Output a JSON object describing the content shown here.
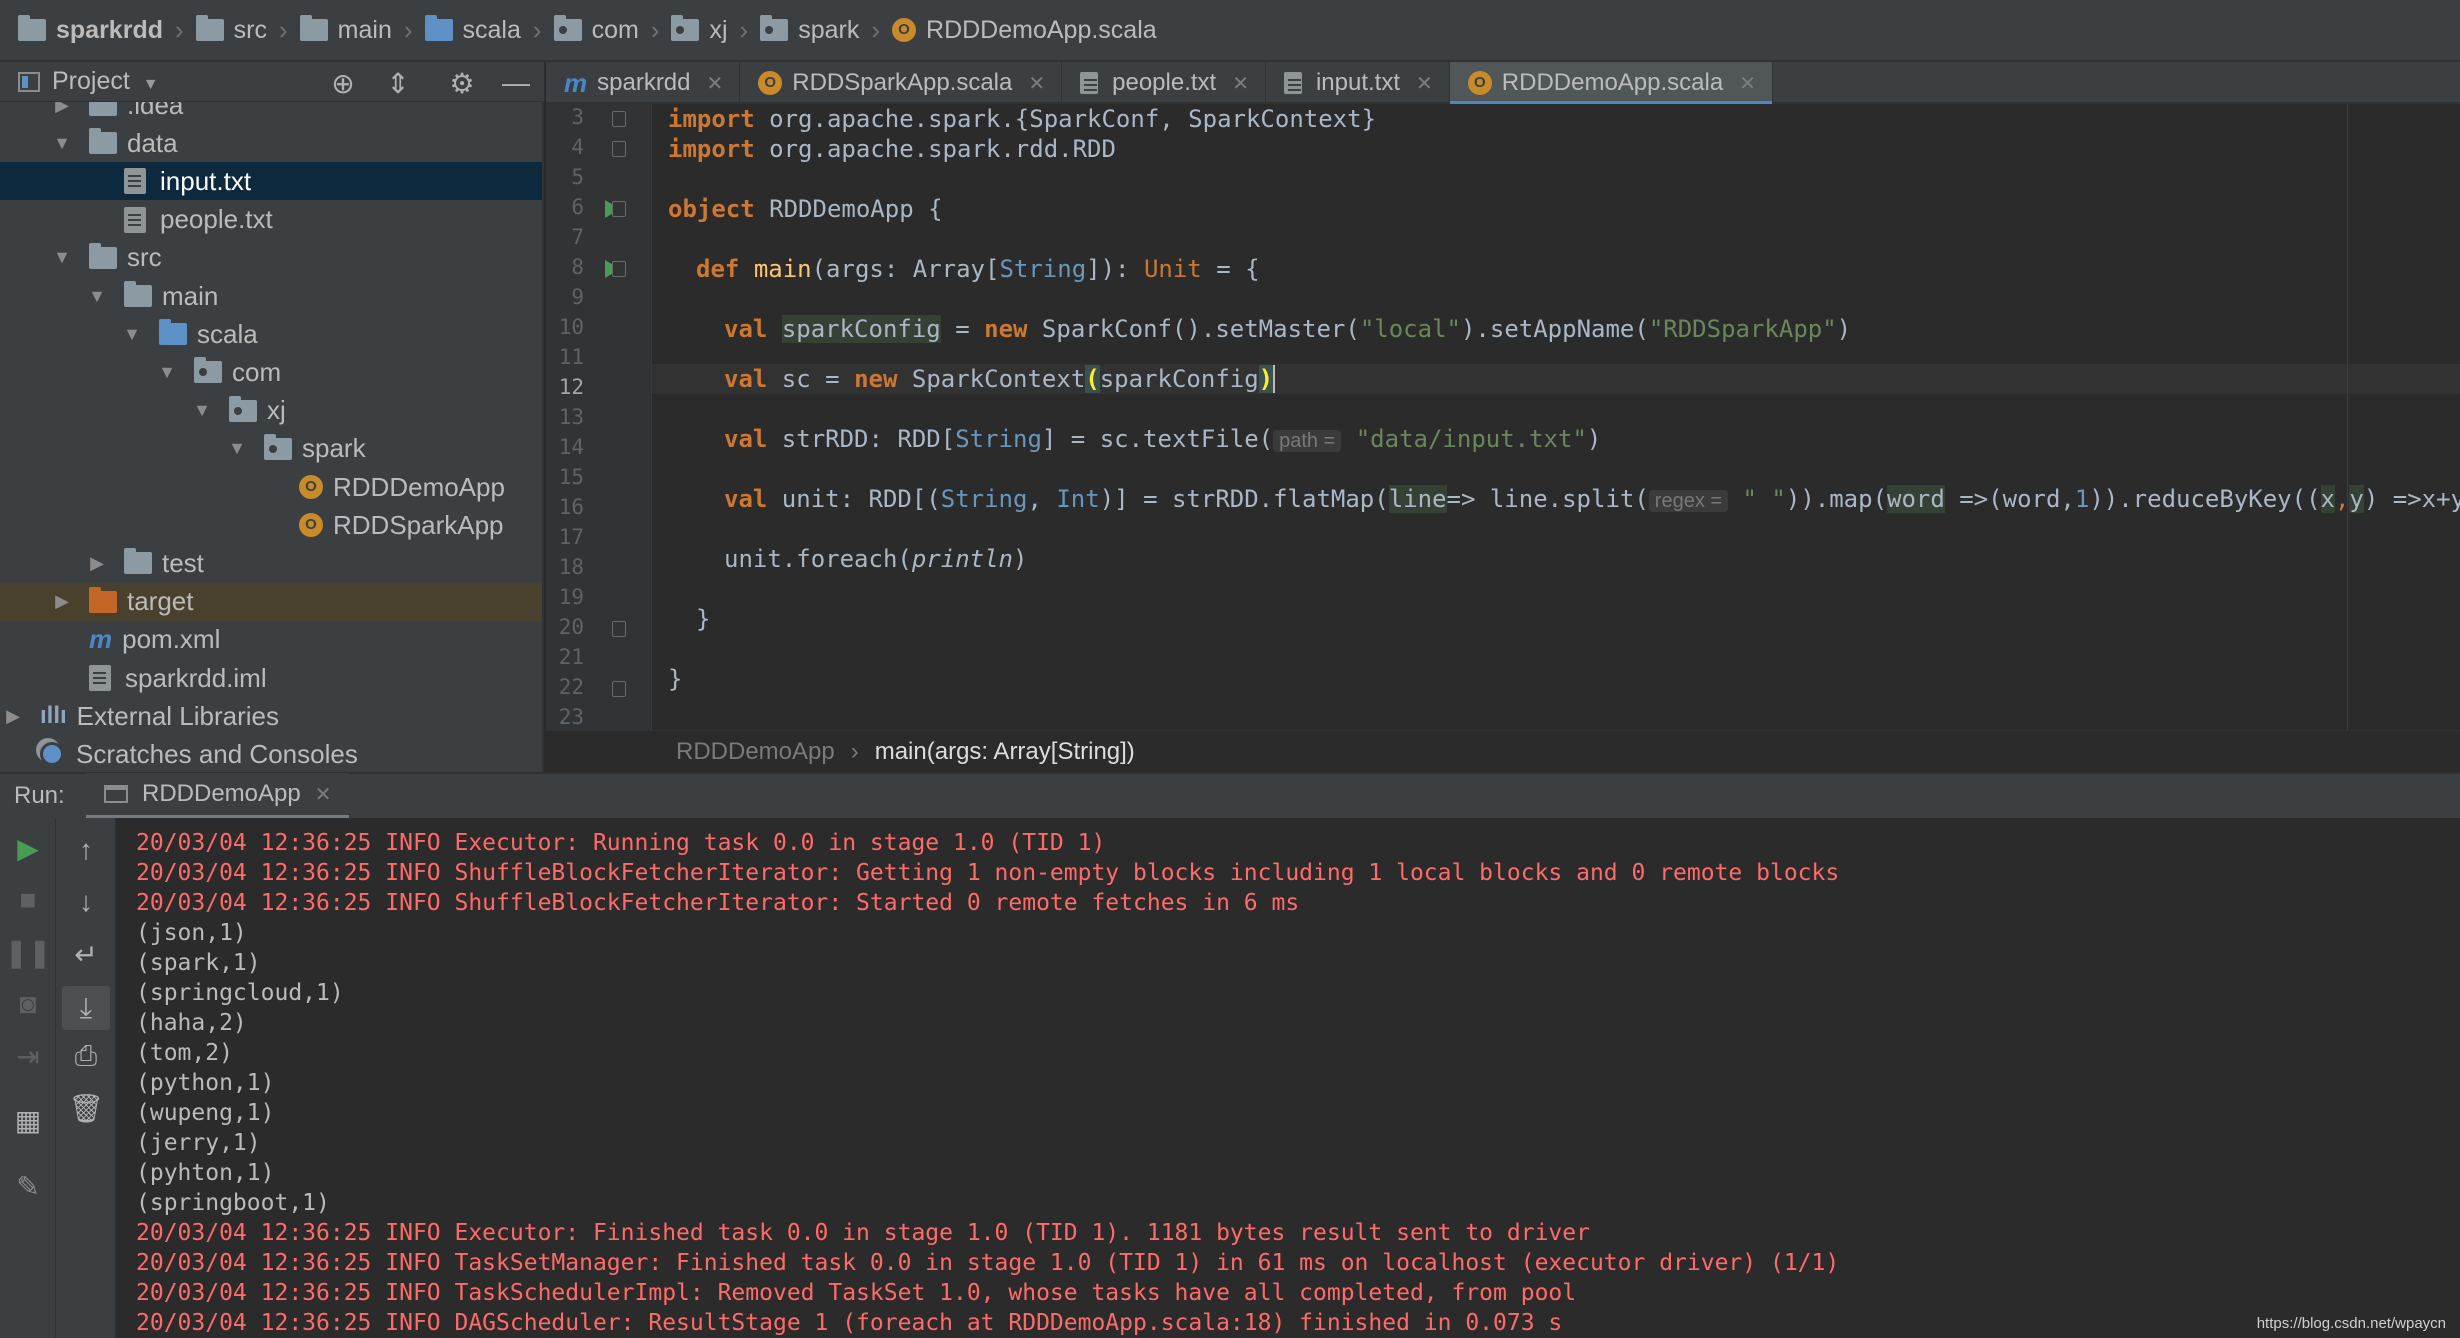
{
  "breadcrumb": [
    "sparkrdd",
    "src",
    "main",
    "scala",
    "com",
    "xj",
    "spark",
    "RDDDemoApp.scala"
  ],
  "project_panel": {
    "title": "Project"
  },
  "tree": [
    {
      "label": ".idea",
      "kind": "folder",
      "depth": 1,
      "expanded": false
    },
    {
      "label": "data",
      "kind": "folder",
      "depth": 1,
      "expanded": true
    },
    {
      "label": "input.txt",
      "kind": "text-file",
      "depth": 2,
      "selected": true
    },
    {
      "label": "people.txt",
      "kind": "text-file",
      "depth": 2
    },
    {
      "label": "src",
      "kind": "folder",
      "depth": 1,
      "expanded": true
    },
    {
      "label": "main",
      "kind": "folder",
      "depth": 2,
      "expanded": true
    },
    {
      "label": "scala",
      "kind": "source-folder",
      "depth": 3,
      "expanded": true
    },
    {
      "label": "com",
      "kind": "package",
      "depth": 4,
      "expanded": true
    },
    {
      "label": "xj",
      "kind": "package",
      "depth": 5,
      "expanded": true
    },
    {
      "label": "spark",
      "kind": "package",
      "depth": 6,
      "expanded": true
    },
    {
      "label": "RDDDemoApp",
      "kind": "scala-object",
      "depth": 7
    },
    {
      "label": "RDDSparkApp",
      "kind": "scala-object",
      "depth": 7
    },
    {
      "label": "test",
      "kind": "folder",
      "depth": 2,
      "expanded": false
    },
    {
      "label": "target",
      "kind": "excluded-folder",
      "depth": 1,
      "expanded": false
    },
    {
      "label": "pom.xml",
      "kind": "maven-file",
      "depth": 1
    },
    {
      "label": "sparkrdd.iml",
      "kind": "iml-file",
      "depth": 1
    },
    {
      "label": "External Libraries",
      "kind": "libraries",
      "depth": 0,
      "expanded": false
    },
    {
      "label": "Scratches and Consoles",
      "kind": "scratches",
      "depth": 0
    }
  ],
  "tabs": [
    {
      "label": "sparkrdd",
      "icon": "maven-icon"
    },
    {
      "label": "RDDSparkApp.scala",
      "icon": "scala-icon"
    },
    {
      "label": "people.txt",
      "icon": "text-file-icon"
    },
    {
      "label": "input.txt",
      "icon": "text-file-icon"
    },
    {
      "label": "RDDDemoApp.scala",
      "icon": "scala-icon",
      "active": true
    }
  ],
  "editor": {
    "line_numbers": [
      "3",
      "4",
      "5",
      "6",
      "7",
      "8",
      "9",
      "10",
      "11",
      "12",
      "13",
      "14",
      "15",
      "16",
      "17",
      "18",
      "19",
      "20",
      "21",
      "22",
      "23"
    ],
    "current_line": "12",
    "hint_path": "path =",
    "hint_regex": "regex =",
    "crumb_object": "RDDDemoApp",
    "crumb_method": "main(args: Array[String])"
  },
  "run": {
    "label": "Run:",
    "tab": "RDDDemoApp",
    "console": [
      {
        "t": "err",
        "text": "20/03/04 12:36:25 INFO Executor: Running task 0.0 in stage 1.0 (TID 1)"
      },
      {
        "t": "err",
        "text": "20/03/04 12:36:25 INFO ShuffleBlockFetcherIterator: Getting 1 non-empty blocks including 1 local blocks and 0 remote blocks"
      },
      {
        "t": "err",
        "text": "20/03/04 12:36:25 INFO ShuffleBlockFetcherIterator: Started 0 remote fetches in 6 ms"
      },
      {
        "t": "out",
        "text": "(json,1)"
      },
      {
        "t": "out",
        "text": "(spark,1)"
      },
      {
        "t": "out",
        "text": "(springcloud,1)"
      },
      {
        "t": "out",
        "text": "(haha,2)"
      },
      {
        "t": "out",
        "text": "(tom,2)"
      },
      {
        "t": "out",
        "text": "(python,1)"
      },
      {
        "t": "out",
        "text": "(wupeng,1)"
      },
      {
        "t": "out",
        "text": "(jerry,1)"
      },
      {
        "t": "out",
        "text": "(pyhton,1)"
      },
      {
        "t": "out",
        "text": "(springboot,1)"
      },
      {
        "t": "err",
        "text": "20/03/04 12:36:25 INFO Executor: Finished task 0.0 in stage 1.0 (TID 1). 1181 bytes result sent to driver"
      },
      {
        "t": "err",
        "text": "20/03/04 12:36:25 INFO TaskSetManager: Finished task 0.0 in stage 1.0 (TID 1) in 61 ms on localhost (executor driver) (1/1)"
      },
      {
        "t": "err",
        "text": "20/03/04 12:36:25 INFO TaskSchedulerImpl: Removed TaskSet 1.0, whose tasks have all completed, from pool"
      },
      {
        "t": "err",
        "text": "20/03/04 12:36:25 INFO DAGScheduler: ResultStage 1 (foreach at RDDDemoApp.scala:18) finished in 0.073 s"
      }
    ],
    "watermark": "https://blog.csdn.net/wpaycn"
  },
  "code": {
    "l3_kw": "import",
    "l3_rest": " org.apache.spark.{SparkConf, SparkContext}",
    "l4_kw": "import",
    "l4_rest": " org.apache.spark.rdd.RDD",
    "l6_kw": "object",
    "l6_rest": " RDDDemoApp {",
    "l8_kw": "def",
    "l8_fn": "main",
    "l8_a": "(args: Array[",
    "l8_ty": "String",
    "l8_b": "]): ",
    "l8_unit": "Unit",
    "l8_c": " = {",
    "l10_kw": "val",
    "l10_var": "sparkConfig",
    "l10_a": " = ",
    "l10_new": "new",
    "l10_b": " SparkConf().setMaster(",
    "l10_s1": "\"local\"",
    "l10_c": ").setAppName(",
    "l10_s2": "\"RDDSparkApp\"",
    "l10_d": ")",
    "l12_kw": "val",
    "l12_a": " sc = ",
    "l12_new": "new",
    "l12_b": " SparkContext",
    "l12_p1": "(",
    "l12_c": "sparkConfig",
    "l12_p2": ")",
    "l14_kw": "val",
    "l14_a": " strRDD: RDD[",
    "l14_ty": "String",
    "l14_b": "] = sc.textFile(",
    "l14_s": "\"data/input.txt\"",
    "l14_c": ")",
    "l16_kw": "val",
    "l16_a": " unit: RDD[(",
    "l16_ty1": "String",
    "l16_b": ", ",
    "l16_ty2": "Int",
    "l16_c": ")] = strRDD.flatMap(",
    "l16_line": "line",
    "l16_d": "=> line.split(",
    "l16_s": "\" \"",
    "l16_e": ")).map(",
    "l16_word": "word",
    "l16_f": " =>(word,",
    "l16_one": "1",
    "l16_g": ")).reduceByKey((",
    "l16_x": "x",
    "l16_comma": ",",
    "l16_y": "y",
    "l16_h": ") =>x+y)",
    "l18_a": "unit.foreach(",
    "l18_b": "println",
    "l18_c": ")",
    "l20": "}",
    "l22": "}"
  }
}
